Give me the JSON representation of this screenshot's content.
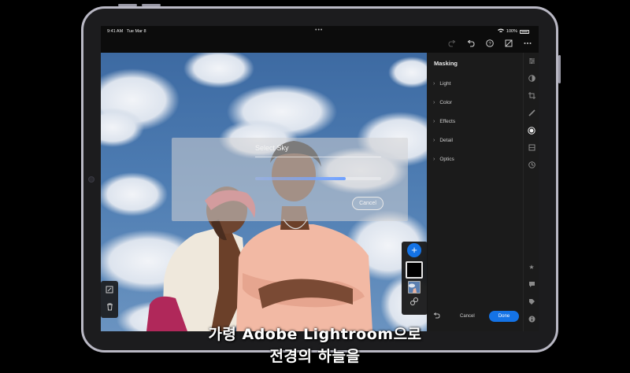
{
  "status_bar": {
    "time": "9:41 AM",
    "date": "Tue Mar 8",
    "battery": "100%",
    "multitask_dots": "•••"
  },
  "toolbar": {
    "icons": [
      "redo-icon",
      "undo-icon",
      "help-icon",
      "compare-icon",
      "more-icon"
    ]
  },
  "select_sky_sheet": {
    "title": "Select Sky",
    "progress": 0.72,
    "cancel_label": "Cancel"
  },
  "masking_panel": {
    "title": "Masking",
    "items": [
      {
        "label": "Light"
      },
      {
        "label": "Color"
      },
      {
        "label": "Effects"
      },
      {
        "label": "Detail"
      },
      {
        "label": "Optics"
      }
    ],
    "cancel_label": "Cancel",
    "done_label": "Done"
  },
  "mask_stack": {
    "add_label": "+"
  },
  "right_rail": {
    "icons": [
      "presets-icon",
      "color-icon",
      "crop-icon",
      "healing-icon",
      "masking-icon",
      "geometry-icon",
      "versions-icon",
      "star-icon",
      "comment-icon",
      "tag-icon",
      "info-icon"
    ]
  },
  "captions": {
    "line1": "가령 Adobe Lightroom으로",
    "line2": "전경의 하늘을"
  },
  "colors": {
    "accent": "#1473e6",
    "panel_bg": "#1b1b1b",
    "device_frame": "#b9b8c4"
  }
}
